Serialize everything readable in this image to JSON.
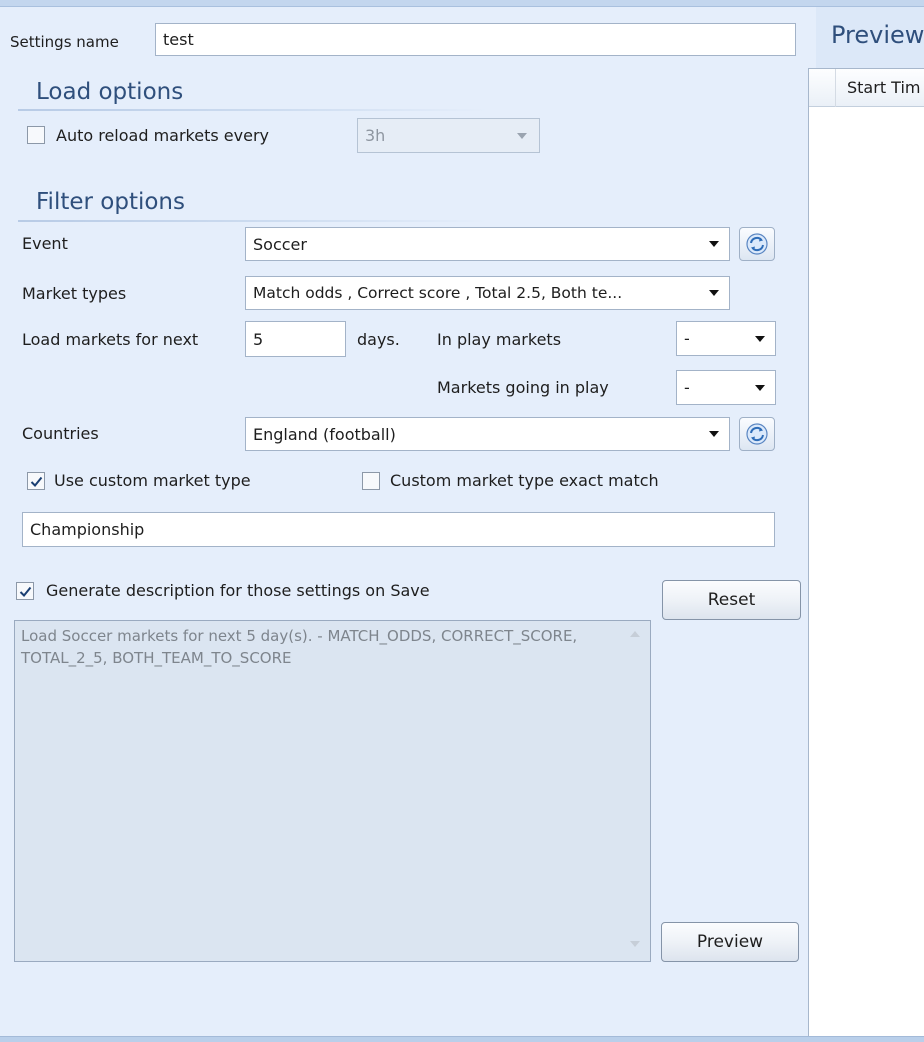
{
  "settings_name": {
    "label": "Settings name",
    "value": "test"
  },
  "load_options": {
    "title": "Load options",
    "auto_reload": {
      "label": "Auto reload markets every",
      "checked": false,
      "value": "3h"
    }
  },
  "filter_options": {
    "title": "Filter options",
    "event": {
      "label": "Event",
      "value": "Soccer"
    },
    "market_types": {
      "label": "Market types",
      "value": "Match odds , Correct score , Total 2.5, Both te..."
    },
    "load_next": {
      "label": "Load markets for next",
      "value": "5",
      "unit": "days."
    },
    "in_play": {
      "label": "In play markets",
      "value": "-"
    },
    "going_in_play": {
      "label": "Markets going in play",
      "value": "-"
    },
    "countries": {
      "label": "Countries",
      "value": "England (football)"
    },
    "custom_market_type": {
      "label": "Use custom market type",
      "checked": true
    },
    "custom_exact": {
      "label": "Custom market type exact match",
      "checked": false
    },
    "custom_value": "Championship"
  },
  "generate_description": {
    "label": "Generate description for those settings on Save",
    "checked": true
  },
  "description_text": "Load Soccer markets for next 5 day(s). - MATCH_ODDS, CORRECT_SCORE, TOTAL_2_5, BOTH_TEAM_TO_SCORE",
  "buttons": {
    "reset": "Reset",
    "preview": "Preview"
  },
  "preview_panel": {
    "title": "Preview",
    "column": "Start Tim"
  },
  "colors": {
    "panel_bg": "#e5eefb",
    "section_text": "#2f4f7c",
    "border": "#a3b3c8"
  },
  "icons": [
    "refresh-icon",
    "checkmark-icon",
    "chevron-down-icon"
  ]
}
